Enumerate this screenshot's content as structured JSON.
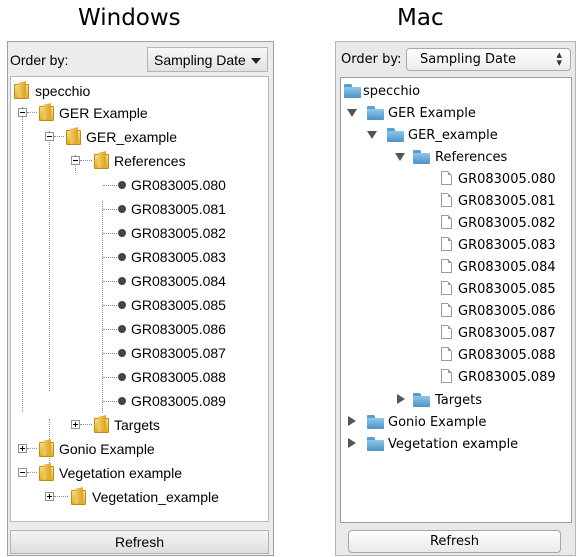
{
  "headings": {
    "windows": "Windows",
    "mac": "Mac"
  },
  "windows_panel": {
    "order_label": "Order by:",
    "order_value": "Sampling Date",
    "refresh_label": "Refresh",
    "tree": {
      "root": "specchio",
      "ger_example": "GER Example",
      "ger_example_child": "GER_example",
      "references": "References",
      "files": [
        "GR083005.080",
        "GR083005.081",
        "GR083005.082",
        "GR083005.083",
        "GR083005.084",
        "GR083005.085",
        "GR083005.086",
        "GR083005.087",
        "GR083005.088",
        "GR083005.089"
      ],
      "targets": "Targets",
      "gonio_example": "Gonio Example",
      "vegetation_example": "Vegetation example",
      "vegetation_example_child": "Vegetation_example"
    }
  },
  "mac_panel": {
    "order_label": "Order by:",
    "order_value": "Sampling Date",
    "refresh_label": "Refresh",
    "tree": {
      "root": "specchio",
      "ger_example": "GER Example",
      "ger_example_child": "GER_example",
      "references": "References",
      "files": [
        "GR083005.080",
        "GR083005.081",
        "GR083005.082",
        "GR083005.083",
        "GR083005.084",
        "GR083005.085",
        "GR083005.086",
        "GR083005.087",
        "GR083005.088",
        "GR083005.089"
      ],
      "targets": "Targets",
      "gonio_example": "Gonio Example",
      "vegetation_example": "Vegetation example"
    }
  },
  "icons": {
    "windows_folder": "folder-icon",
    "windows_leaf": "bullet-icon",
    "mac_folder": "folder-icon",
    "mac_leaf": "document-icon"
  },
  "colors": {
    "windows_folder": "#e8b43a",
    "mac_folder": "#5fa6d6"
  }
}
